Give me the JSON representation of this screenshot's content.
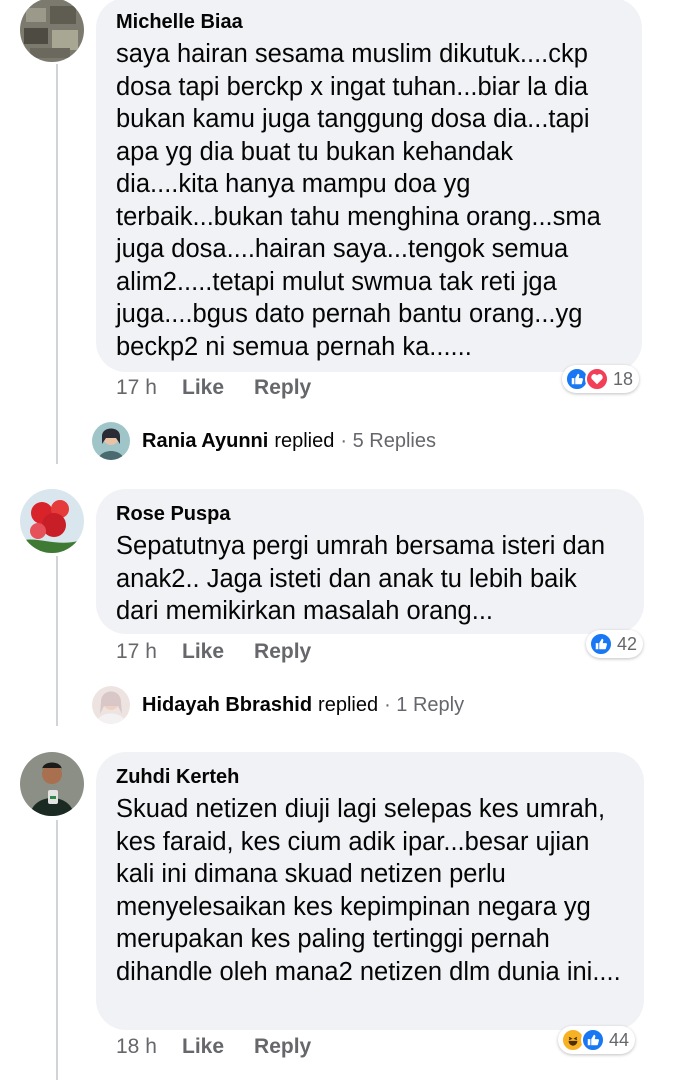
{
  "comments": [
    {
      "author": "Michelle Biaa",
      "text": "saya hairan sesama muslim dikutuk....ckp dosa tapi berckp x ingat tuhan...biar la dia bukan kamu juga tanggung dosa dia...tapi apa yg dia buat tu bukan kehandak dia....kita hanya mampu doa yg terbaik...bukan tahu menghina orang...sma juga dosa....hairan saya...tengok semua alim2.....tetapi mulut swmua tak reti jga juga....bgus dato pernah bantu orang...yg beckp2 ni semua pernah ka......",
      "time": "17 h",
      "like_label": "Like",
      "reply_label": "Reply",
      "reactions": [
        "like",
        "love"
      ],
      "reaction_count": "18",
      "replies": {
        "name": "Rania Ayunni",
        "verb": "replied",
        "count": "· 5 Replies"
      }
    },
    {
      "author": "Rose Puspa",
      "text": "Sepatutnya pergi umrah bersama isteri dan anak2..  Jaga isteti dan anak tu lebih baik dari memikirkan masalah orang...",
      "time": "17 h",
      "like_label": "Like",
      "reply_label": "Reply",
      "reactions": [
        "like"
      ],
      "reaction_count": "42",
      "replies": {
        "name": "Hidayah Bbrashid",
        "verb": "replied",
        "count": "· 1 Reply"
      }
    },
    {
      "author": "Zuhdi Kerteh",
      "text": "Skuad netizen diuji lagi selepas kes umrah, kes faraid, kes cium adik ipar...besar ujian kali ini dimana skuad netizen perlu menyelesaikan kes  kepimpinan negara yg merupakan kes paling tertinggi pernah dihandle oleh mana2 netizen dlm dunia ini....",
      "time": "18 h",
      "like_label": "Like",
      "reply_label": "Reply",
      "reactions": [
        "haha",
        "like"
      ],
      "reaction_count": "44"
    }
  ],
  "colors": {
    "bubble": "#f0f2f5",
    "meta": "#65676b",
    "like_blue": "#1877f2",
    "love_red": "#f33e58",
    "haha_yellow": "#f7b125"
  }
}
